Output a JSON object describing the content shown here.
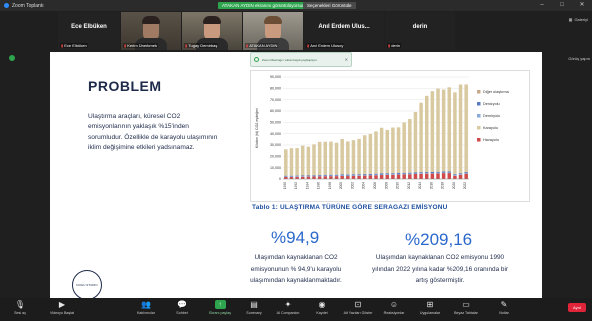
{
  "window": {
    "app_title": "Zoom Toplantı",
    "share_notice": "ATAKAN AYDIN ekranını görüntülüyorsunuz",
    "view_options": "Seçenekleri Görüntüle",
    "minimize": "–",
    "maximize": "□",
    "close": "✕"
  },
  "gallery_label": "Galeriyi",
  "right_status": "Görüş yapın",
  "participants": [
    {
      "big_name": "Ece Elbüken",
      "label": "Ece Elbüken"
    },
    {
      "big_name": "",
      "label": "Kerim Ünerkmek"
    },
    {
      "big_name": "",
      "label": "Tugay Demirbaş"
    },
    {
      "big_name": "",
      "label": "ATAKAN AYDIN"
    },
    {
      "big_name": "Anıl Erdem Ulus...",
      "label": "Anıl Erdem Ulusoy"
    },
    {
      "big_name": "derin",
      "label": "derin"
    }
  ],
  "banner": {
    "text": "Zoom Meetings / ekran kaydı paylaşılıyor"
  },
  "slide": {
    "title": "PROBLEM",
    "body": "Ulaştırma araçları, küresel CO2 emisyonlarının yaklaşık %15'inden sorumludur. Özellikle de karayolu ulaşımının iklim değişimine etkileri yadsınamaz.",
    "table_caption": "Tablo 1: ULAŞTIRMA TÜRÜNE GÖRE SERAGAZI EMİSYONU",
    "stat1_value": "%94,9",
    "stat1_text": "Ulaşımdan kaynaklanan CO2 emisyonunun % 94,9'u karayolu ulaşımından kaynaklanmaktadır.",
    "stat2_value": "%209,16",
    "stat2_text": "Ulaşımdan kaynaklanan CO2 emisyonu 1990 yılından 2022 yılına kadar %209,16 oranında bir artış göstermiştir.",
    "logo_text": "DOGU STUDIO"
  },
  "chart_data": {
    "type": "bar",
    "ylabel": "Kiloton (kt) CO2 eşdeğeri",
    "ylim": [
      0,
      90000
    ],
    "yticks": [
      "0",
      "10,000",
      "20,000",
      "30,000",
      "40,000",
      "50,000",
      "60,000",
      "70,000",
      "80,000",
      "90,000"
    ],
    "categories": [
      "1990",
      "1991",
      "1992",
      "1993",
      "1994",
      "1995",
      "1996",
      "1997",
      "1998",
      "1999",
      "2000",
      "2001",
      "2002",
      "2003",
      "2004",
      "2005",
      "2006",
      "2007",
      "2008",
      "2009",
      "2010",
      "2011",
      "2012",
      "2013",
      "2014",
      "2015",
      "2016",
      "2017",
      "2018",
      "2019",
      "2020",
      "2021",
      "2022"
    ],
    "xtick_labels": [
      "1990",
      "",
      "1992",
      "",
      "1994",
      "",
      "1996",
      "",
      "1998",
      "",
      "2000",
      "",
      "2002",
      "",
      "2004",
      "",
      "2006",
      "",
      "2008",
      "",
      "2010",
      "",
      "2012",
      "",
      "2014",
      "",
      "2016",
      "",
      "2018",
      "",
      "2020",
      "",
      "2022"
    ],
    "series": [
      {
        "name": "Diğer ulaştırma",
        "color": "#c8a88a",
        "values": [
          300,
          300,
          300,
          300,
          300,
          300,
          300,
          300,
          300,
          300,
          300,
          300,
          300,
          300,
          300,
          300,
          300,
          300,
          300,
          300,
          300,
          300,
          300,
          300,
          300,
          300,
          300,
          300,
          300,
          300,
          300,
          300,
          300
        ]
      },
      {
        "name": "Denizyolu",
        "color": "#5a7bbf",
        "values": [
          600,
          600,
          600,
          600,
          600,
          600,
          700,
          700,
          700,
          700,
          800,
          800,
          800,
          800,
          800,
          800,
          900,
          900,
          900,
          900,
          900,
          900,
          900,
          900,
          900,
          900,
          900,
          900,
          900,
          900,
          900,
          900,
          900
        ]
      },
      {
        "name": "Demiryolu",
        "color": "#8aa8d8",
        "values": [
          500,
          500,
          500,
          500,
          500,
          500,
          500,
          500,
          500,
          500,
          500,
          500,
          500,
          500,
          500,
          500,
          500,
          500,
          500,
          500,
          500,
          500,
          500,
          500,
          500,
          500,
          500,
          500,
          500,
          500,
          500,
          500,
          500
        ]
      },
      {
        "name": "Karayolu",
        "color": "#d9c9a0",
        "values": [
          23000,
          24000,
          24000,
          26000,
          25000,
          27000,
          29000,
          29000,
          29000,
          28000,
          31000,
          29000,
          30000,
          31000,
          34000,
          35000,
          37000,
          40000,
          38000,
          40000,
          40000,
          44000,
          47000,
          53000,
          61000,
          67000,
          71000,
          73000,
          72000,
          74000,
          72000,
          78000,
          77000
        ]
      },
      {
        "name": "Havayolu",
        "color": "#d04a4a",
        "values": [
          1800,
          1800,
          1900,
          2000,
          2100,
          2200,
          2300,
          2400,
          2500,
          2500,
          2700,
          2600,
          2700,
          2800,
          3000,
          3100,
          3300,
          3500,
          3600,
          3700,
          3900,
          4100,
          4200,
          4400,
          4600,
          4700,
          4800,
          5000,
          5200,
          5200,
          2800,
          3700,
          4700
        ]
      }
    ],
    "legend_position": "right"
  },
  "toolbar": {
    "items": [
      {
        "label": "Sesi aç",
        "icon": "microphone-icon"
      },
      {
        "label": "Videoyu Başlat",
        "icon": "video-camera-icon"
      },
      {
        "label": "Katılımcılar",
        "icon": "participants-icon"
      },
      {
        "label": "Sohbet",
        "icon": "chat-icon"
      },
      {
        "label": "Ekranı paylaş",
        "icon": "share-screen-icon"
      },
      {
        "label": "Summary",
        "icon": "summary-icon"
      },
      {
        "label": "AI Companion",
        "icon": "ai-companion-icon"
      },
      {
        "label": "Kaydet",
        "icon": "record-icon"
      },
      {
        "label": "Alt Yazıları Göster",
        "icon": "captions-icon"
      },
      {
        "label": "Reaksiyonlar",
        "icon": "reactions-icon"
      },
      {
        "label": "Uygulamalar",
        "icon": "apps-icon"
      },
      {
        "label": "Beyaz Tahtalar",
        "icon": "whiteboard-icon"
      },
      {
        "label": "Notlar",
        "icon": "notes-icon"
      }
    ],
    "end_label": "Ayrıl"
  },
  "colors": {
    "accent_green": "#2fa44f",
    "slide_blue": "#2b68cc",
    "end_red": "#e0243a"
  }
}
